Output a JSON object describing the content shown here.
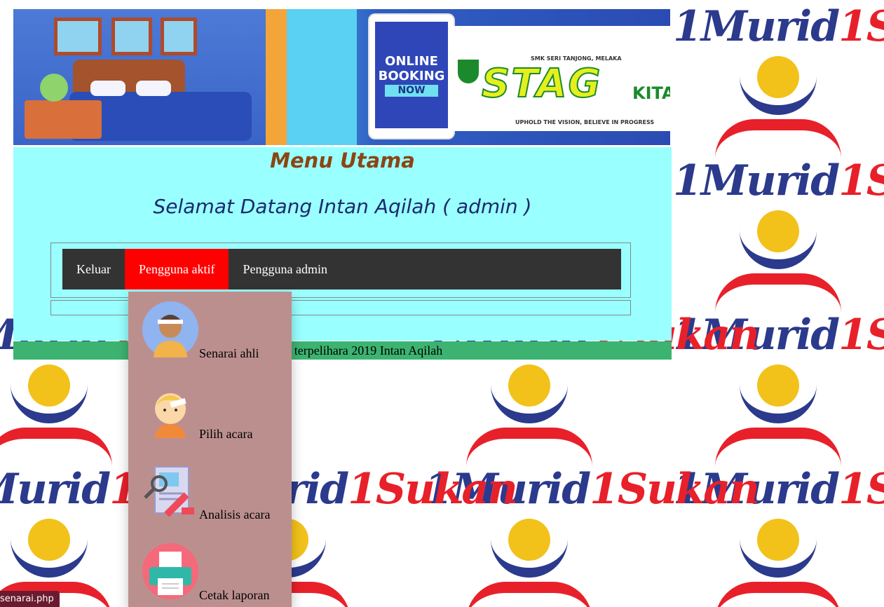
{
  "background": {
    "tile_word_1": "1Murid",
    "tile_word_2": "1Sukan"
  },
  "banner": {
    "phone_line1": "ONLINE",
    "phone_line2": "BOOKING",
    "phone_line3": "NOW",
    "school_name": "SMK SERI TANJONG, MELAKA",
    "logo_text": "STAG",
    "logo_suffix": "KITA",
    "tagline": "UPHOLD THE VISION, BELIEVE IN PROGRESS"
  },
  "main": {
    "title": "Menu Utama",
    "welcome": "Selamat Datang Intan Aqilah ( admin )"
  },
  "nav": {
    "items": [
      {
        "label": "Keluar"
      },
      {
        "label": "Pengguna aktif"
      },
      {
        "label": "Pengguna admin"
      }
    ]
  },
  "dropdown": {
    "items": [
      {
        "label": "Senarai ahli",
        "icon": "member-avatar-icon"
      },
      {
        "label": "Pilih acara",
        "icon": "athlete-icon"
      },
      {
        "label": "Analisis acara",
        "icon": "analysis-report-icon"
      },
      {
        "label": "Cetak laporan",
        "icon": "printer-icon"
      }
    ]
  },
  "footer": {
    "text": "Hak cipta terpelihara 2019 Intan Aqilah"
  },
  "status_url": "senarai.php",
  "colors": {
    "main_bg": "#99ffff",
    "nav_bg": "#333333",
    "nav_active": "#ff0000",
    "dropdown_bg": "#bc8f8f",
    "footer_bg": "#3cb371",
    "title_color": "#8b4513"
  }
}
